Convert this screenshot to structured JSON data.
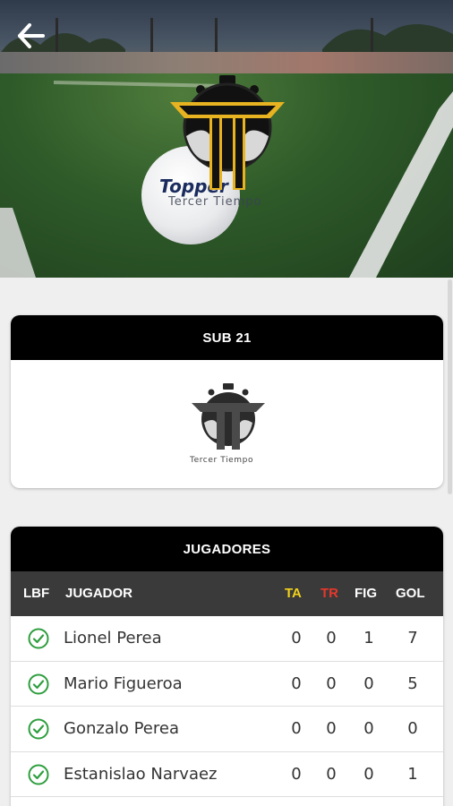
{
  "hero": {
    "ball_brand": "Topper",
    "logo_caption": "Tercer Tiempo"
  },
  "team_card": {
    "title": "SUB 21",
    "logo_caption": "Tercer Tiempo"
  },
  "players_card": {
    "title": "JUGADORES",
    "columns": {
      "lbf": "LBF",
      "player": "JUGADOR",
      "ta": "TA",
      "tr": "TR",
      "fig": "FIG",
      "gol": "GOL"
    },
    "rows": [
      {
        "name": "Lionel Perea",
        "ta": "0",
        "tr": "0",
        "fig": "1",
        "gol": "7"
      },
      {
        "name": "Mario Figueroa",
        "ta": "0",
        "tr": "0",
        "fig": "0",
        "gol": "5"
      },
      {
        "name": "Gonzalo Perea",
        "ta": "0",
        "tr": "0",
        "fig": "0",
        "gol": "0"
      },
      {
        "name": "Estanislao Narvaez",
        "ta": "0",
        "tr": "0",
        "fig": "0",
        "gol": "1"
      }
    ]
  },
  "colors": {
    "header_bg": "#000000",
    "table_head_bg": "#3a3a3a",
    "ta_color": "#f2d21b",
    "tr_color": "#e8372c",
    "check_color": "#2e9e3e",
    "logo_gold": "#e8b321"
  },
  "icons": {
    "back": "arrow-left-icon",
    "check": "check-circle-icon"
  }
}
